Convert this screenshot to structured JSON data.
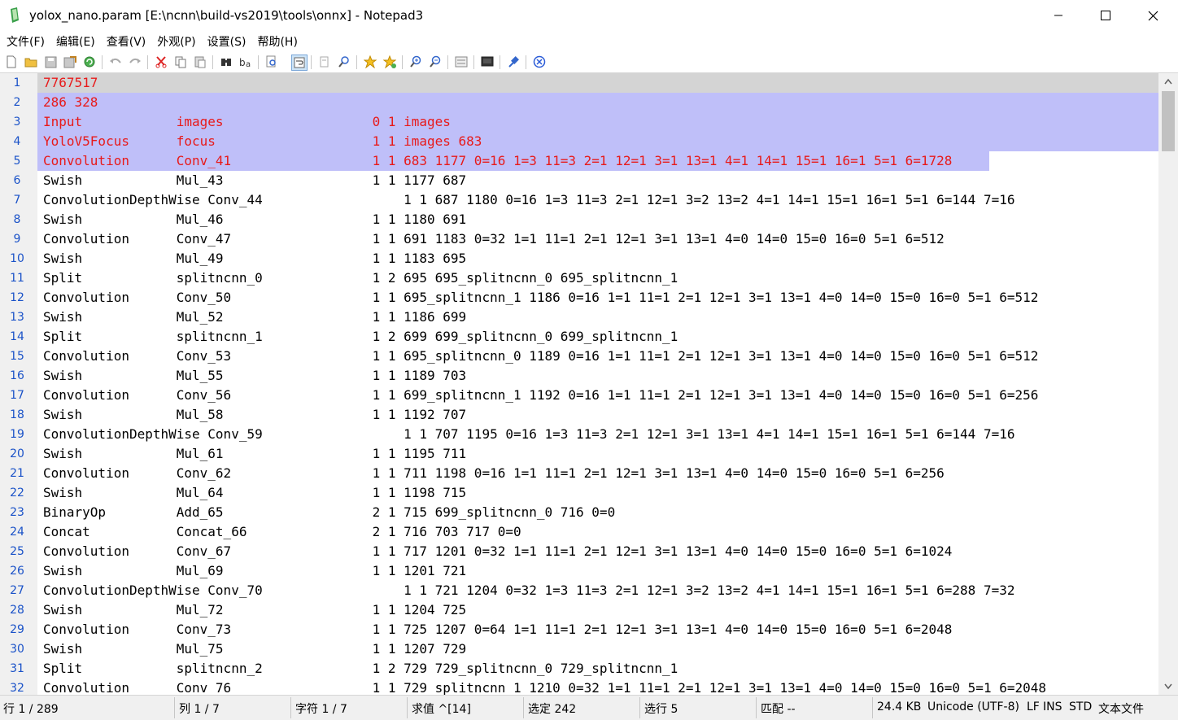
{
  "window": {
    "title": "yolox_nano.param [E:\\ncnn\\build-vs2019\\tools\\onnx] - Notepad3",
    "minimize_label": "—",
    "maximize_label": "☐",
    "close_label": "✕"
  },
  "menu": [
    {
      "label": "文件(F)"
    },
    {
      "label": "编辑(E)"
    },
    {
      "label": "查看(V)"
    },
    {
      "label": "外观(P)"
    },
    {
      "label": "设置(S)"
    },
    {
      "label": "帮助(H)"
    }
  ],
  "editor": {
    "lines": [
      {
        "num": "1",
        "text": "7767517"
      },
      {
        "num": "2",
        "text": "286 328"
      },
      {
        "num": "3",
        "text": "Input            images                   0 1 images"
      },
      {
        "num": "4",
        "text": "YoloV5Focus      focus                    1 1 images 683"
      },
      {
        "num": "5",
        "text": "Convolution      Conv_41                  1 1 683 1177 0=16 1=3 11=3 2=1 12=1 3=1 13=1 4=1 14=1 15=1 16=1 5=1 6=1728"
      },
      {
        "num": "6",
        "text": "Swish            Mul_43                   1 1 1177 687"
      },
      {
        "num": "7",
        "text": "ConvolutionDepthWise Conv_44                  1 1 687 1180 0=16 1=3 11=3 2=1 12=1 3=2 13=2 4=1 14=1 15=1 16=1 5=1 6=144 7=16"
      },
      {
        "num": "8",
        "text": "Swish            Mul_46                   1 1 1180 691"
      },
      {
        "num": "9",
        "text": "Convolution      Conv_47                  1 1 691 1183 0=32 1=1 11=1 2=1 12=1 3=1 13=1 4=0 14=0 15=0 16=0 5=1 6=512"
      },
      {
        "num": "10",
        "text": "Swish            Mul_49                   1 1 1183 695"
      },
      {
        "num": "11",
        "text": "Split            splitncnn_0              1 2 695 695_splitncnn_0 695_splitncnn_1"
      },
      {
        "num": "12",
        "text": "Convolution      Conv_50                  1 1 695_splitncnn_1 1186 0=16 1=1 11=1 2=1 12=1 3=1 13=1 4=0 14=0 15=0 16=0 5=1 6=512"
      },
      {
        "num": "13",
        "text": "Swish            Mul_52                   1 1 1186 699"
      },
      {
        "num": "14",
        "text": "Split            splitncnn_1              1 2 699 699_splitncnn_0 699_splitncnn_1"
      },
      {
        "num": "15",
        "text": "Convolution      Conv_53                  1 1 695_splitncnn_0 1189 0=16 1=1 11=1 2=1 12=1 3=1 13=1 4=0 14=0 15=0 16=0 5=1 6=512"
      },
      {
        "num": "16",
        "text": "Swish            Mul_55                   1 1 1189 703"
      },
      {
        "num": "17",
        "text": "Convolution      Conv_56                  1 1 699_splitncnn_1 1192 0=16 1=1 11=1 2=1 12=1 3=1 13=1 4=0 14=0 15=0 16=0 5=1 6=256"
      },
      {
        "num": "18",
        "text": "Swish            Mul_58                   1 1 1192 707"
      },
      {
        "num": "19",
        "text": "ConvolutionDepthWise Conv_59                  1 1 707 1195 0=16 1=3 11=3 2=1 12=1 3=1 13=1 4=1 14=1 15=1 16=1 5=1 6=144 7=16"
      },
      {
        "num": "20",
        "text": "Swish            Mul_61                   1 1 1195 711"
      },
      {
        "num": "21",
        "text": "Convolution      Conv_62                  1 1 711 1198 0=16 1=1 11=1 2=1 12=1 3=1 13=1 4=0 14=0 15=0 16=0 5=1 6=256"
      },
      {
        "num": "22",
        "text": "Swish            Mul_64                   1 1 1198 715"
      },
      {
        "num": "23",
        "text": "BinaryOp         Add_65                   2 1 715 699_splitncnn_0 716 0=0"
      },
      {
        "num": "24",
        "text": "Concat           Concat_66                2 1 716 703 717 0=0"
      },
      {
        "num": "25",
        "text": "Convolution      Conv_67                  1 1 717 1201 0=32 1=1 11=1 2=1 12=1 3=1 13=1 4=0 14=0 15=0 16=0 5=1 6=1024"
      },
      {
        "num": "26",
        "text": "Swish            Mul_69                   1 1 1201 721"
      },
      {
        "num": "27",
        "text": "ConvolutionDepthWise Conv_70                  1 1 721 1204 0=32 1=3 11=3 2=1 12=1 3=2 13=2 4=1 14=1 15=1 16=1 5=1 6=288 7=32"
      },
      {
        "num": "28",
        "text": "Swish            Mul_72                   1 1 1204 725"
      },
      {
        "num": "29",
        "text": "Convolution      Conv_73                  1 1 725 1207 0=64 1=1 11=1 2=1 12=1 3=1 13=1 4=0 14=0 15=0 16=0 5=1 6=2048"
      },
      {
        "num": "30",
        "text": "Swish            Mul_75                   1 1 1207 729"
      },
      {
        "num": "31",
        "text": "Split            splitncnn_2              1 2 729 729_splitncnn_0 729_splitncnn_1"
      },
      {
        "num": "32",
        "text": "Convolution      Conv_76                  1 1 729_splitncnn_1 1210 0=32 1=1 11=1 2=1 12=1 3=1 13=1 4=0 14=0 15=0 16=0 5=1 6=2048"
      }
    ]
  },
  "status": {
    "line": "行 1 / 289",
    "column": "列 1 / 7",
    "char": "字符 1 / 7",
    "eval": "求值  ^[14]",
    "selected": "选定 242",
    "sel_lines": "选行 5",
    "match": "匹配 --",
    "size": "24.4 KB",
    "encoding": "Unicode (UTF-8)",
    "eol": "LF",
    "ins": "INS",
    "std": "STD",
    "type": "文本文件"
  },
  "colors": {
    "selection": "#bfbff9",
    "current_line": "#d4d4d4",
    "line_number": "#1a52c8",
    "selected_text": "#e81a1a"
  }
}
